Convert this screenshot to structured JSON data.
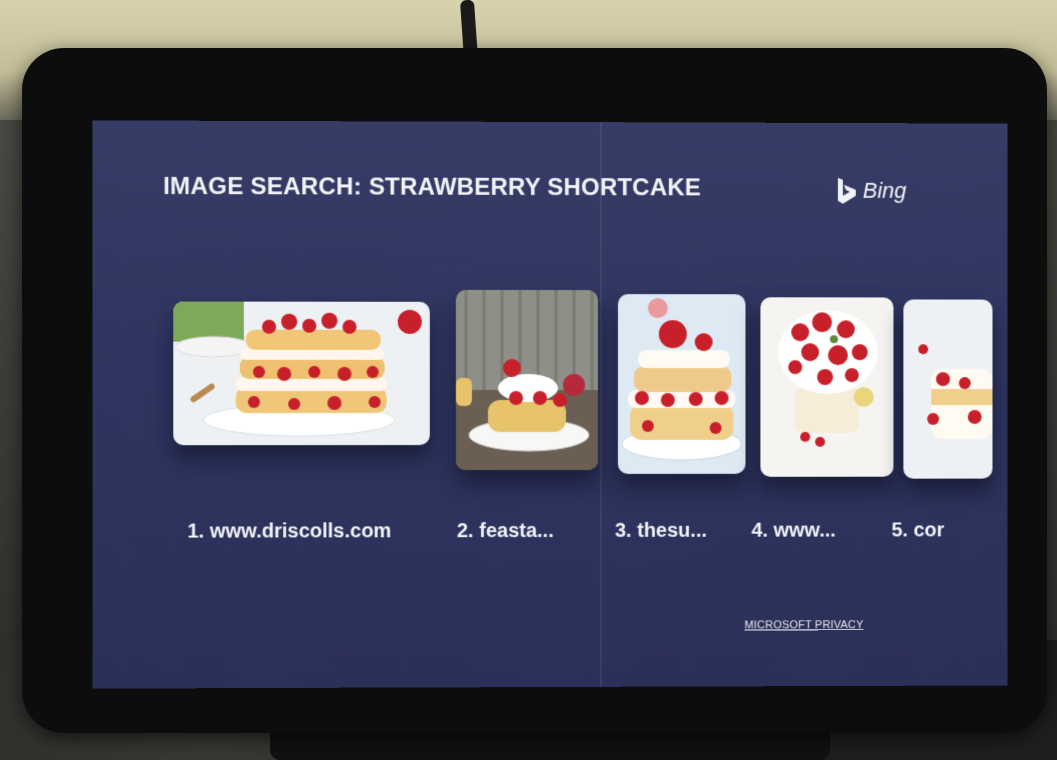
{
  "header": {
    "title": "IMAGE SEARCH: STRAWBERRY SHORTCAKE",
    "brand_label": "Bing",
    "brand_icon": "bing-logo-icon"
  },
  "results": [
    {
      "label": "1. www.driscolls.com"
    },
    {
      "label": "2. feasta..."
    },
    {
      "label": "3. thesu..."
    },
    {
      "label": "4. www..."
    },
    {
      "label": "5. cor"
    }
  ],
  "footer": {
    "privacy_link": "MICROSOFT PRIVACY"
  },
  "colors": {
    "screen_bg": "#2f3560",
    "text": "#f2f3f7",
    "strawberry": "#c8202b"
  }
}
